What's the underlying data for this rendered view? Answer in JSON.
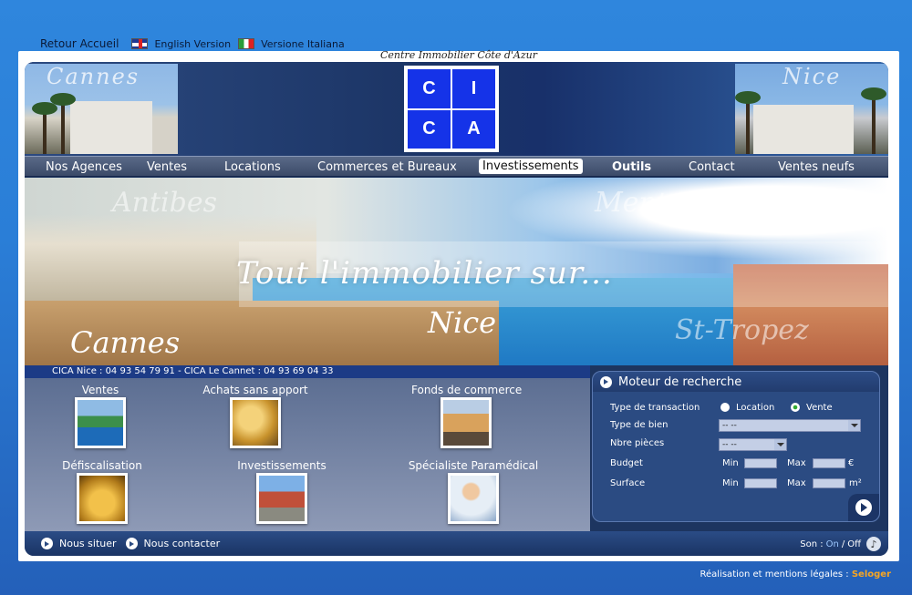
{
  "top_links": {
    "home": "Retour Accueil",
    "english": "English Version",
    "italian": "Versione Italiana"
  },
  "subtitle": "Centre Immobilier Côte d'Azur",
  "header": {
    "left_city": "Cannes",
    "right_city": "Nice",
    "logo_letters": [
      "C",
      "I",
      "C",
      "A"
    ]
  },
  "nav": {
    "items": [
      {
        "label": "Nos Agences"
      },
      {
        "label": "Ventes"
      },
      {
        "label": "Locations"
      },
      {
        "label": "Commerces et Bureaux"
      },
      {
        "label": "Investissements",
        "active": true
      },
      {
        "label": "Outils",
        "bold": true
      },
      {
        "label": "Contact"
      },
      {
        "label": "Ventes neufs"
      }
    ]
  },
  "banner": {
    "headline": "Tout l'immobilier sur...",
    "cities": {
      "antibes": "Antibes",
      "menton": "Menton",
      "nice": "Nice",
      "cannes": "Cannes",
      "st": "St-Tropez"
    }
  },
  "phones": "CICA Nice : 04 93 54 79 91 - CICA Le Cannet : 04 93 69 04 33",
  "tiles": [
    {
      "label": "Ventes",
      "icon": "coastline-photo"
    },
    {
      "label": "Achats sans apport",
      "icon": "keys-photo"
    },
    {
      "label": "Fonds de commerce",
      "icon": "street-photo"
    },
    {
      "label": "Défiscalisation",
      "icon": "gold-coins-photo"
    },
    {
      "label": "Investissements",
      "icon": "building-photo"
    },
    {
      "label": "Spécialiste Paramédical",
      "icon": "nurse-photo"
    }
  ],
  "search": {
    "title": "Moteur de recherche",
    "transaction_label": "Type de transaction",
    "option_location": "Location",
    "option_vente": "Vente",
    "selected_transaction": "Vente",
    "type_bien_label": "Type de bien",
    "type_bien_value": "-- --",
    "pieces_label": "Nbre pièces",
    "pieces_value": "-- --",
    "budget_label": "Budget",
    "surface_label": "Surface",
    "min_label": "Min",
    "max_label": "Max",
    "budget_unit": "€",
    "surface_unit": "m²"
  },
  "footer": {
    "situer": "Nous situer",
    "contact": "Nous contacter",
    "sound_label": "Son :",
    "sound_on": "On",
    "sound_sep": "/",
    "sound_off": "Off"
  },
  "credits": {
    "text": "Réalisation et mentions légales :",
    "brand": "Seloger"
  }
}
